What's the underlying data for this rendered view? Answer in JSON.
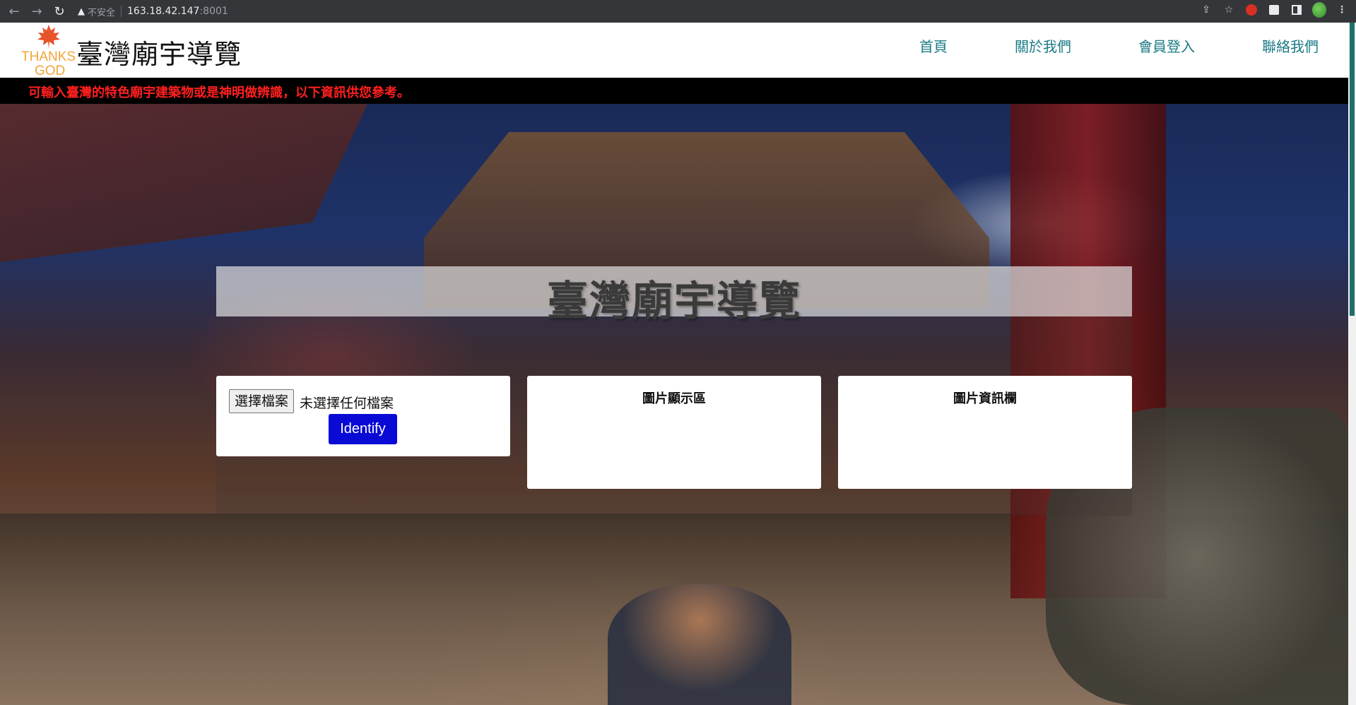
{
  "browser": {
    "security_label": "不安全",
    "url_host": "163.18.42.147",
    "url_port": ":8001"
  },
  "header": {
    "logo_text_line1": "THANKS",
    "logo_text_line2": "GOD",
    "title": "臺灣廟宇導覽",
    "nav": [
      "首頁",
      "關於我們",
      "會員登入",
      "聯絡我們"
    ]
  },
  "notice": {
    "text": "可輸入臺灣的特色廟宇建築物或是神明做辨識，以下資訊供您參考。"
  },
  "main": {
    "panel_title": "臺灣廟宇導覽",
    "upload": {
      "choose_file_label": "選擇檔案",
      "file_status": "未選擇任何檔案",
      "identify_label": "Identify"
    },
    "image_card_heading": "圖片顯示區",
    "info_card_heading": "圖片資訊欄"
  },
  "colors": {
    "nav_link": "#1b7a86",
    "notice_text": "#ff1f1f",
    "identify_button": "#0a0ad6",
    "logo_accent": "#f2a43a"
  }
}
